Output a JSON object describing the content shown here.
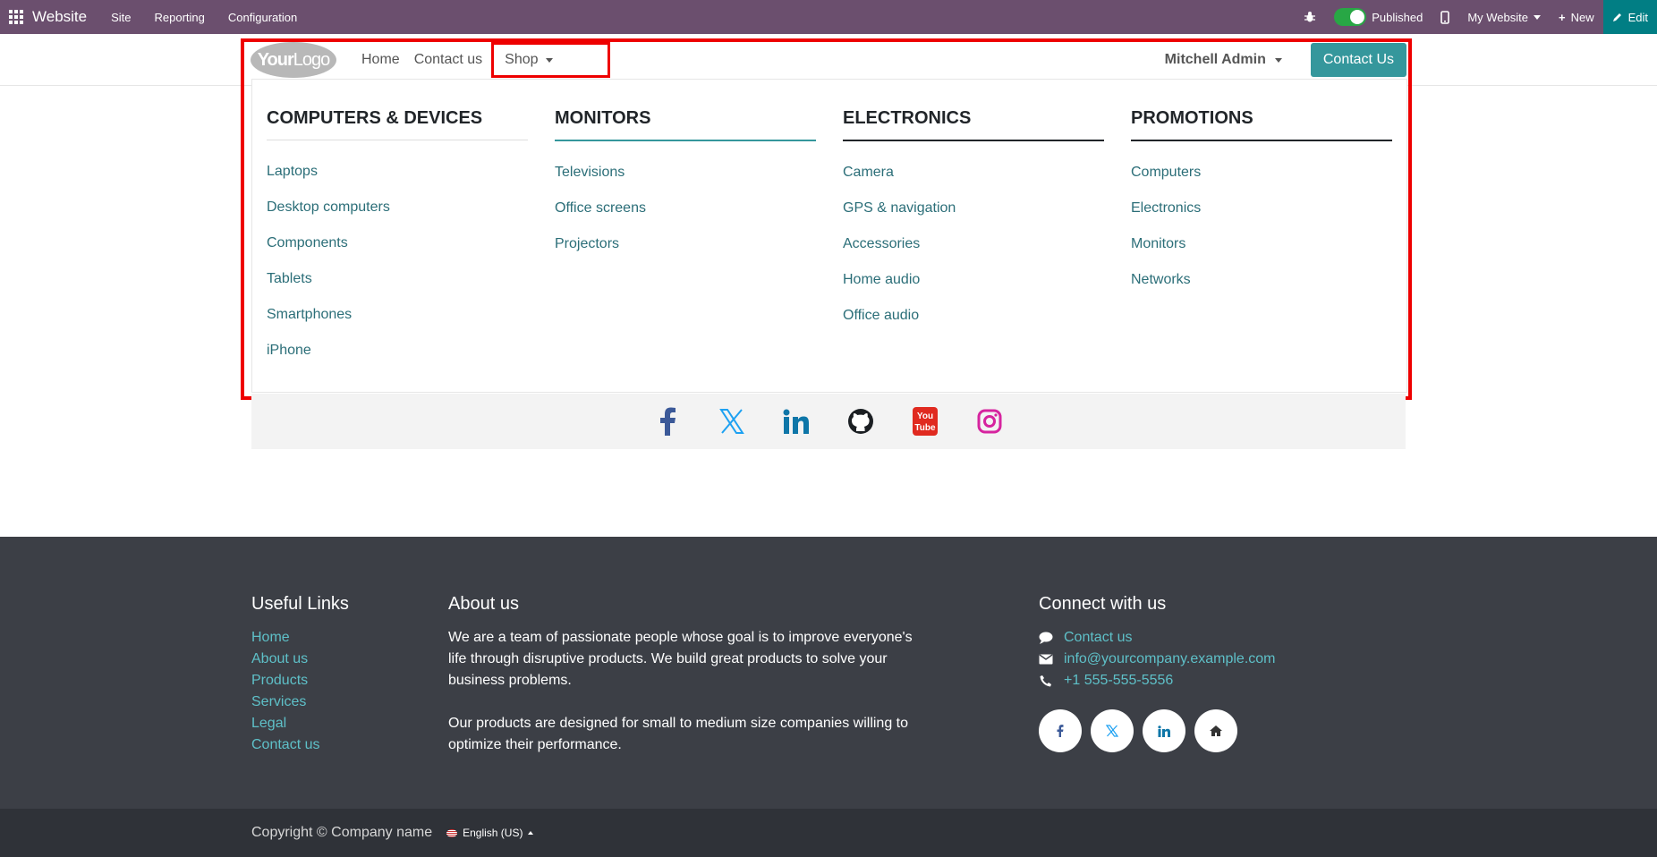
{
  "admin_bar": {
    "app_name": "Website",
    "menu": [
      "Site",
      "Reporting",
      "Configuration"
    ],
    "published_label": "Published",
    "website_label": "My Website",
    "new_label": "New",
    "edit_label": "Edit"
  },
  "header": {
    "logo_text_bold": "Your",
    "logo_text_rest": "Logo",
    "nav": [
      "Home",
      "Contact us"
    ],
    "shop_label": "Shop",
    "user_label": "Mitchell Admin",
    "cta_label": "Contact Us"
  },
  "mega_menu": {
    "columns": [
      {
        "title": "COMPUTERS & DEVICES",
        "links": [
          "Laptops",
          "Desktop computers",
          "Components",
          "Tablets",
          "Smartphones",
          "iPhone"
        ]
      },
      {
        "title": "MONITORS",
        "links": [
          "Televisions",
          "Office screens",
          "Projectors"
        ]
      },
      {
        "title": "ELECTRONICS",
        "links": [
          "Camera",
          "GPS & navigation",
          "Accessories",
          "Home audio",
          "Office audio"
        ]
      },
      {
        "title": "PROMOTIONS",
        "links": [
          "Computers",
          "Electronics",
          "Monitors",
          "Networks"
        ]
      }
    ]
  },
  "social_band": {
    "icons": [
      "facebook-icon",
      "x-twitter-icon",
      "linkedin-icon",
      "github-icon",
      "youtube-icon",
      "instagram-icon"
    ]
  },
  "footer": {
    "useful_links": {
      "title": "Useful Links",
      "links": [
        "Home",
        "About us",
        "Products",
        "Services",
        "Legal",
        "Contact us"
      ]
    },
    "about": {
      "title": "About us",
      "paragraphs": [
        "We are a team of passionate people whose goal is to improve everyone's life through disruptive products. We build great products to solve your business problems.",
        "Our products are designed for small to medium size companies willing to optimize their performance."
      ]
    },
    "connect": {
      "title": "Connect with us",
      "contact_link": "Contact us",
      "email": "info@yourcompany.example.com",
      "phone": "+1 555-555-5556"
    },
    "copyright": "Copyright © Company name",
    "language": "English (US)"
  },
  "colors": {
    "admin_bar": "#6b4f6e",
    "accent": "#35979c",
    "link": "#2b6e78",
    "footer_bg": "#3c3f46",
    "highlight": "#ee0000"
  }
}
